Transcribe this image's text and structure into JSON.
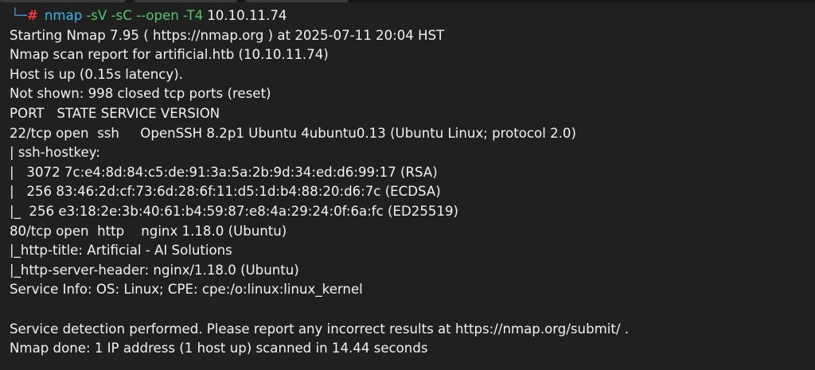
{
  "prompt": {
    "corner": "└─",
    "symbol": "#",
    "command": "nmap",
    "arguments": "-sV -sC --open -T4",
    "target": "10.10.11.74"
  },
  "output_lines": [
    "Starting Nmap 7.95 ( https://nmap.org ) at 2025-07-11 20:04 HST",
    "Nmap scan report for artificial.htb (10.10.11.74)",
    "Host is up (0.15s latency).",
    "Not shown: 998 closed tcp ports (reset)",
    "PORT   STATE SERVICE VERSION",
    "22/tcp open  ssh     OpenSSH 8.2p1 Ubuntu 4ubuntu0.13 (Ubuntu Linux; protocol 2.0)",
    "| ssh-hostkey:",
    "|   3072 7c:e4:8d:84:c5:de:91:3a:5a:2b:9d:34:ed:d6:99:17 (RSA)",
    "|   256 83:46:2d:cf:73:6d:28:6f:11:d5:1d:b4:88:20:d6:7c (ECDSA)",
    "|_  256 e3:18:2e:3b:40:61:b4:59:87:e8:4a:29:24:0f:6a:fc (ED25519)",
    "80/tcp open  http    nginx 1.18.0 (Ubuntu)",
    "|_http-title: Artificial - AI Solutions",
    "|_http-server-header: nginx/1.18.0 (Ubuntu)",
    "Service Info: OS: Linux; CPE: cpe:/o:linux:linux_kernel",
    "",
    "Service detection performed. Please report any incorrect results at https://nmap.org/submit/ .",
    "Nmap done: 1 IP address (1 host up) scanned in 14.44 seconds"
  ],
  "colors": {
    "background": "#202020",
    "text": "#f2f2f2",
    "prompt_corner": "#4a8cd6",
    "prompt_symbol": "#ff3535",
    "command": "#3db3e6",
    "arguments": "#4fc76a"
  }
}
